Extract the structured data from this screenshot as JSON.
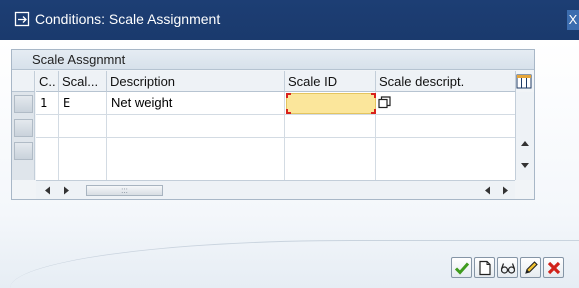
{
  "window": {
    "title": "Conditions: Scale Assignment",
    "close_label": "X"
  },
  "table": {
    "title": "Scale Assgnmnt",
    "columns": [
      {
        "label": "C.."
      },
      {
        "label": "Scal..."
      },
      {
        "label": "Description"
      },
      {
        "label": "Scale ID"
      },
      {
        "label": "Scale descript."
      }
    ],
    "rows": [
      {
        "c": "1",
        "scale": "E",
        "description": "Net weight",
        "scale_id": "",
        "scale_descript": ""
      },
      {
        "c": "",
        "scale": "",
        "description": "",
        "scale_id": "",
        "scale_descript": ""
      },
      {
        "c": "",
        "scale": "",
        "description": "",
        "scale_id": "",
        "scale_descript": ""
      }
    ],
    "scroll_thumb_grip": ":::"
  },
  "toolbar": {
    "buttons": [
      {
        "name": "continue",
        "icon": "checkmark-icon"
      },
      {
        "name": "new",
        "icon": "new-document-icon"
      },
      {
        "name": "display",
        "icon": "glasses-icon"
      },
      {
        "name": "change",
        "icon": "pencil-icon"
      },
      {
        "name": "cancel",
        "icon": "cancel-icon"
      }
    ]
  },
  "colors": {
    "titlebar": "#1d3e74",
    "input_highlight": "#fbe69b",
    "continue_green": "#3f9b1e",
    "cancel_red": "#d1221a"
  }
}
